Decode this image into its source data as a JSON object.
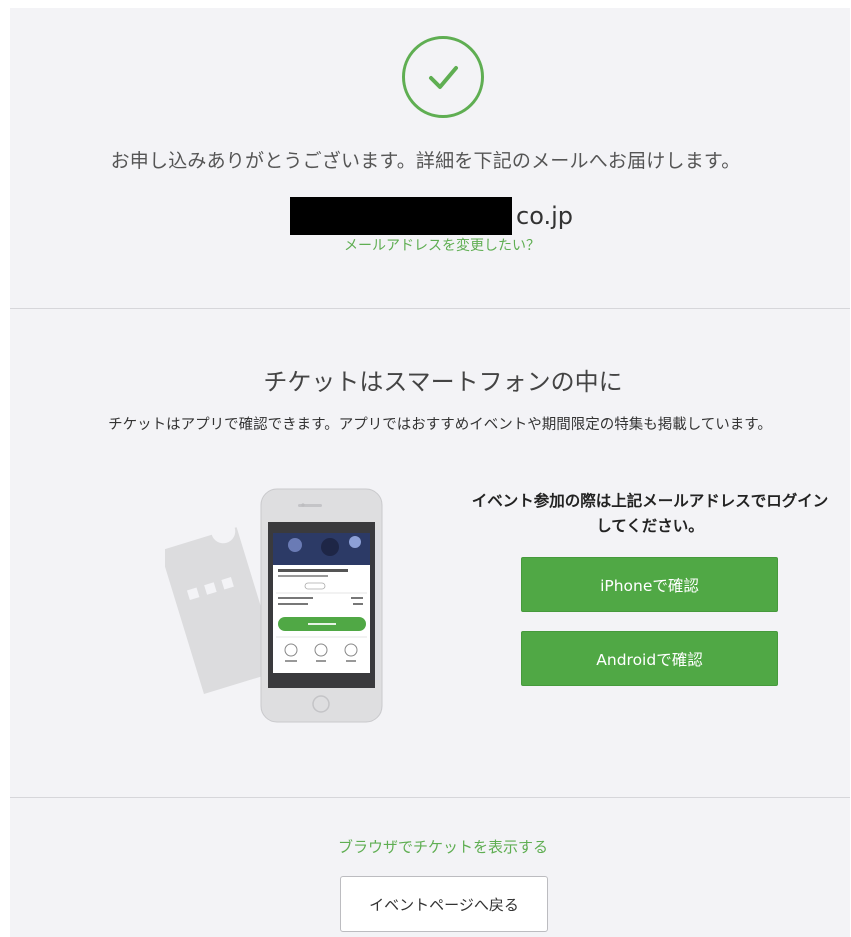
{
  "confirmation": {
    "message": "お申し込みありがとうございます。詳細を下記のメールへお届けします。",
    "email_suffix": "co.jp",
    "change_email_link": "メールアドレスを変更したい？"
  },
  "app_section": {
    "title": "チケットはスマートフォンの中に",
    "description": "チケットはアプリで確認できます。アプリではおすすめイベントや期間限定の特集も掲載しています。",
    "login_note": "イベント参加の際は上記メールアドレスでログインしてください。",
    "iphone_button": "iPhoneで確認",
    "android_button": "Androidで確認"
  },
  "footer": {
    "browser_link": "ブラウザでチケットを表示する",
    "back_button": "イベントページへ戻る"
  },
  "colors": {
    "accent": "#5fae52",
    "button": "#50a845",
    "background": "#f3f3f6"
  },
  "icons": [
    "checkmark-circle-icon",
    "ticket-icon",
    "smartphone-icon"
  ]
}
